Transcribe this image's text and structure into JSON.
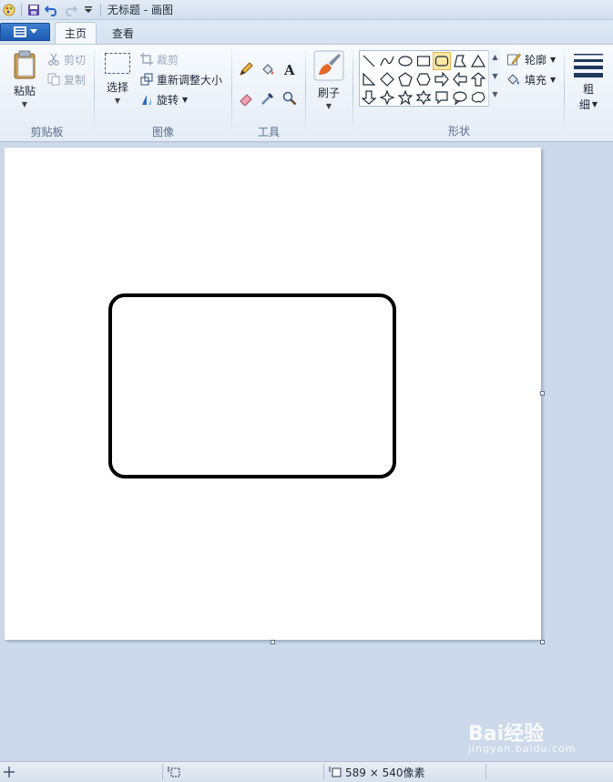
{
  "titlebar": {
    "title": "无标题 - 画图"
  },
  "tabs": {
    "home": "主页",
    "view": "查看"
  },
  "clipboard": {
    "paste": "粘贴",
    "cut": "剪切",
    "copy": "复制",
    "group_label": "剪贴板"
  },
  "image": {
    "select": "选择",
    "crop": "裁剪",
    "resize": "重新调整大小",
    "rotate": "旋转",
    "group_label": "图像"
  },
  "tools": {
    "group_label": "工具"
  },
  "brushes": {
    "label": "刷子"
  },
  "shapes": {
    "outline": "轮廓",
    "fill": "填充",
    "group_label": "形状"
  },
  "size": {
    "label_top": "粗",
    "label_bottom": "细"
  },
  "statusbar": {
    "canvas_size": "589 × 540像素"
  },
  "watermark": {
    "main": "Bai经验",
    "sub": "jingyan.baidu.com"
  },
  "colors": {
    "accent": "#1c5bb3",
    "selected_shape": "#fde8a6",
    "workspace": "#ccd9ea"
  }
}
